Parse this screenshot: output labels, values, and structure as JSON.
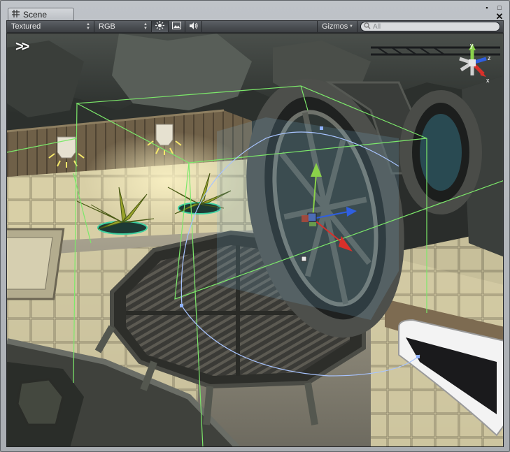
{
  "window": {
    "tab_label": "Scene",
    "tab_icon": "scene-grid-icon",
    "buttons": {
      "menu": "▪",
      "maximize": "□",
      "close": "✕"
    }
  },
  "toolbar": {
    "draw_mode": "Textured",
    "render_mode": "RGB",
    "lighting_icon": "sun-icon",
    "image_icon": "image-icon",
    "audio_icon": "speaker-icon",
    "gizmos_label": "Gizmos",
    "search_placeholder": "All",
    "search_icon": "search-icon"
  },
  "viewport": {
    "camera_move_glyph": ">>",
    "orientation_axes": {
      "y": "y",
      "x": "x",
      "z": "z"
    },
    "colors": {
      "axis_x": "#d9302a",
      "axis_y": "#8ad14a",
      "axis_z": "#2f5fe0",
      "bounds_wire": "#7ce86a",
      "rotate_arc": "#a8c4ff"
    }
  }
}
